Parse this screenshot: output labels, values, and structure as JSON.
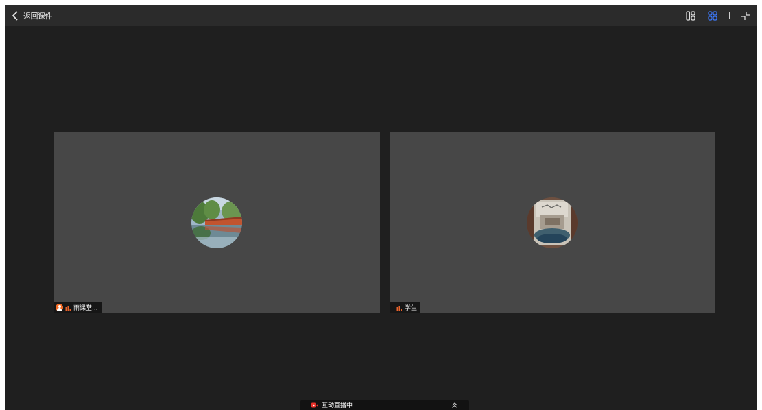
{
  "header": {
    "back_label": "返回课件",
    "icons": [
      "chevron-left-icon",
      "layout-speaker-icon",
      "layout-grid-icon",
      "exit-fullscreen-icon"
    ],
    "active_layout": "grid",
    "accent_color": "#3d7bff"
  },
  "participants": [
    {
      "name": "雨课堂...",
      "role_icon": "teacher-icon",
      "mic_icon": "mic-level-icon",
      "avatar": "landscape-river-photo"
    },
    {
      "name": "学生",
      "role_icon": null,
      "mic_icon": "mic-level-icon",
      "avatar": "painting-photo"
    }
  ],
  "live_bar": {
    "label": "互动直播中",
    "status_color": "#e8322b",
    "icons": [
      "live-camera-icon",
      "chevron-double-up-icon"
    ]
  }
}
